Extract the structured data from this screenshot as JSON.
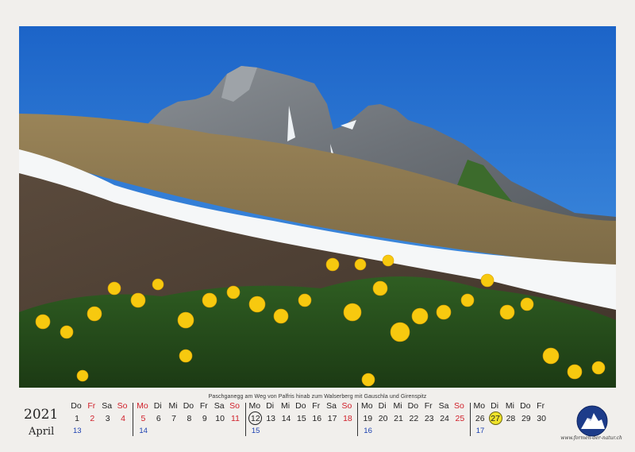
{
  "caption": "Paschganegg am Weg von Palfris hinab zum Walserberg mit Gauschla und Girenspitz",
  "year": "2021",
  "month": "April",
  "logo_url": "www.formen-der-natur.ch",
  "colors": {
    "weekend_red": "#d0202a",
    "week_blue": "#1a3fb0",
    "highlight_yellow": "#f0e32a"
  },
  "calendar": {
    "days": [
      {
        "dn": "Do",
        "d": "1"
      },
      {
        "dn": "Fr",
        "d": "2",
        "red": true
      },
      {
        "dn": "Sa",
        "d": "3"
      },
      {
        "dn": "So",
        "d": "4",
        "red": true
      },
      {
        "dn": "Mo",
        "d": "5",
        "red": true
      },
      {
        "dn": "Di",
        "d": "6"
      },
      {
        "dn": "Mi",
        "d": "7"
      },
      {
        "dn": "Do",
        "d": "8"
      },
      {
        "dn": "Fr",
        "d": "9"
      },
      {
        "dn": "Sa",
        "d": "10"
      },
      {
        "dn": "So",
        "d": "11",
        "red": true
      },
      {
        "dn": "Mo",
        "d": "12",
        "circle": "outline"
      },
      {
        "dn": "Di",
        "d": "13"
      },
      {
        "dn": "Mi",
        "d": "14"
      },
      {
        "dn": "Do",
        "d": "15"
      },
      {
        "dn": "Fr",
        "d": "16"
      },
      {
        "dn": "Sa",
        "d": "17"
      },
      {
        "dn": "So",
        "d": "18",
        "red": true
      },
      {
        "dn": "Mo",
        "d": "19"
      },
      {
        "dn": "Di",
        "d": "20"
      },
      {
        "dn": "Mi",
        "d": "21"
      },
      {
        "dn": "Do",
        "d": "22"
      },
      {
        "dn": "Fr",
        "d": "23"
      },
      {
        "dn": "Sa",
        "d": "24"
      },
      {
        "dn": "So",
        "d": "25",
        "red": true
      },
      {
        "dn": "Mo",
        "d": "26"
      },
      {
        "dn": "Di",
        "d": "27",
        "circle": "yellow"
      },
      {
        "dn": "Mi",
        "d": "28"
      },
      {
        "dn": "Do",
        "d": "29"
      },
      {
        "dn": "Fr",
        "d": "30"
      }
    ],
    "weeks": [
      "13",
      "14",
      "15",
      "16",
      "17"
    ]
  }
}
